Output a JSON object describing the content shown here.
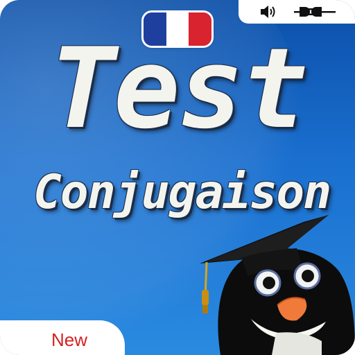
{
  "title": {
    "line1": "Test",
    "line2": "Conjugaison"
  },
  "badge": {
    "label": "New"
  },
  "flag": {
    "colors": [
      "#1f3f9e",
      "#ffffff",
      "#d9232e"
    ],
    "icon": "france-flag-icon"
  },
  "status": {
    "sound_icon": "speaker-icon",
    "plug_icon": "plug-icon"
  },
  "palette": {
    "background": "#1a6fcf",
    "title_text": "#f4f4ef",
    "new_text": "#d62020"
  }
}
